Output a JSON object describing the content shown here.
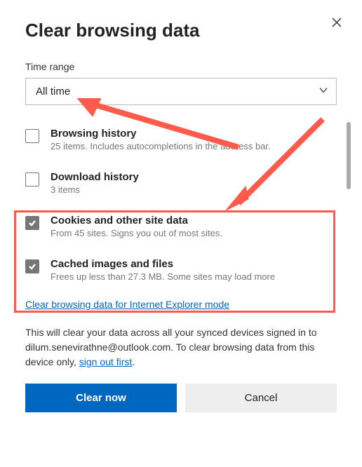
{
  "dialog": {
    "title": "Clear browsing data",
    "timeRangeLabel": "Time range",
    "timeRangeValue": "All time",
    "options": [
      {
        "label": "Browsing history",
        "sub": "25 items. Includes autocompletions in the address bar.",
        "checked": false
      },
      {
        "label": "Download history",
        "sub": "3 items",
        "checked": false
      },
      {
        "label": "Cookies and other site data",
        "sub": "From 45 sites. Signs you out of most sites.",
        "checked": true
      },
      {
        "label": "Cached images and files",
        "sub": "Frees up less than 27.3 MB. Some sites may load more",
        "checked": true
      }
    ],
    "ieLink": "Clear browsing data for Internet Explorer mode",
    "infoPrefix": "This will clear your data across all your synced devices signed in to dilum.senevirathne@outlook.com. To clear browsing data from this device only, ",
    "signOutLink": "sign out first",
    "infoSuffix": ".",
    "clearBtn": "Clear now",
    "cancelBtn": "Cancel"
  }
}
